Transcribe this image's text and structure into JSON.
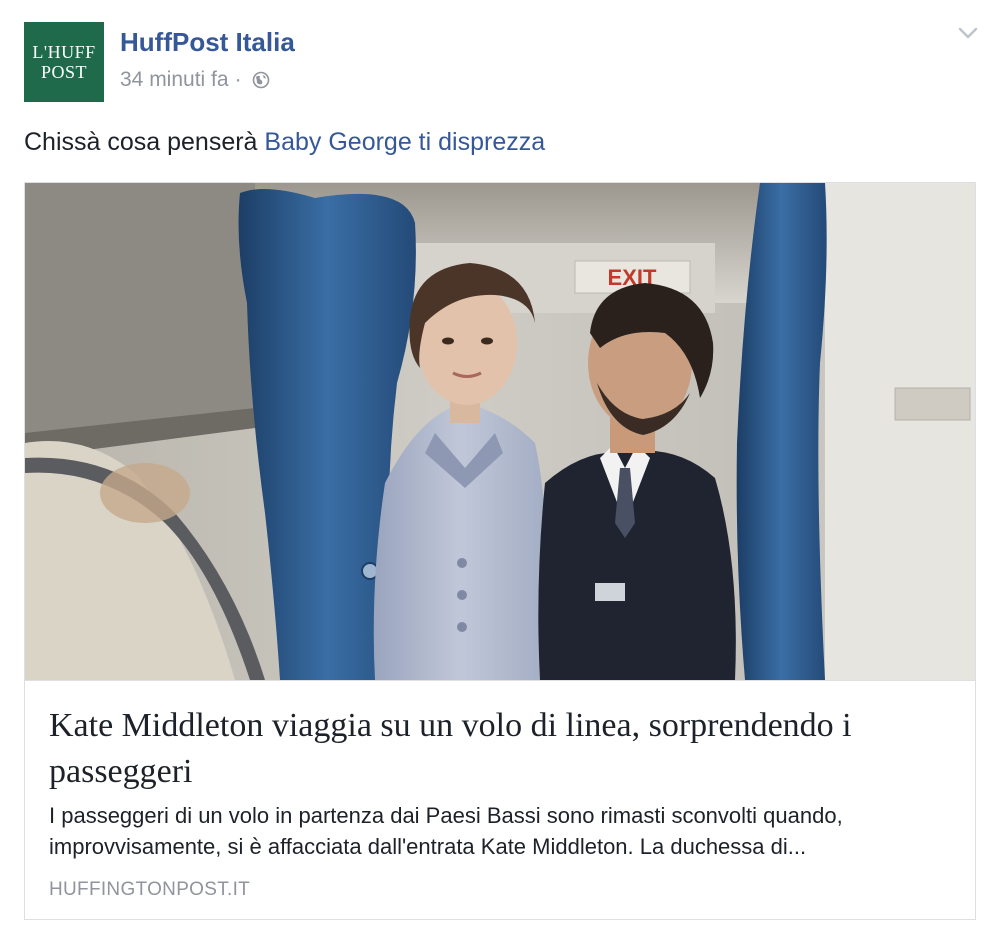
{
  "post": {
    "page_name": "HuffPost Italia",
    "avatar": {
      "line1": "L'HUFF",
      "line2": "POST",
      "bg_color": "#1f6a4b"
    },
    "timestamp": "34 minuti fa",
    "separator": "·",
    "privacy_icon": "globe-icon",
    "options_icon": "chevron-down-icon",
    "message_text": "Chissà cosa penserà",
    "message_link": "Baby George ti disprezza"
  },
  "link_card": {
    "image_icon": "photo",
    "exit_sign": "EXIT",
    "title": "Kate Middleton viaggia su un volo di linea, sorprendendo i passeggeri",
    "description": "I passeggeri di un volo in partenza dai Paesi Bassi sono rimasti sconvolti quando, improvvisamente, si è affacciata dall'entrata Kate Middleton. La duchessa di...",
    "domain": "HUFFINGTONPOST.IT"
  },
  "colors": {
    "link": "#365899",
    "text": "#1d2129",
    "muted": "#90949c",
    "border": "#dddfe2"
  }
}
